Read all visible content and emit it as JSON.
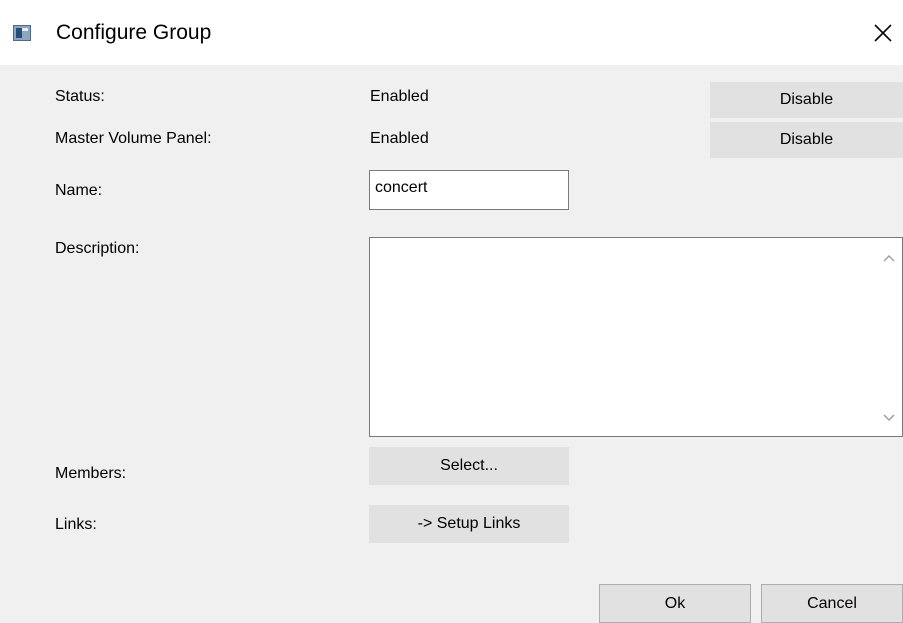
{
  "window": {
    "title": "Configure Group",
    "close_glyph": "✕",
    "icon": "app-window-icon"
  },
  "form": {
    "status": {
      "label": "Status:",
      "value": "Enabled",
      "button": "Disable"
    },
    "master_volume": {
      "label": "Master Volume Panel:",
      "value": "Enabled",
      "button": "Disable"
    },
    "name": {
      "label": "Name:",
      "value": "concert"
    },
    "description": {
      "label": "Description:",
      "value": ""
    },
    "members": {
      "label": "Members:",
      "button": "Select..."
    },
    "links": {
      "label": "Links:",
      "button": "-> Setup Links"
    }
  },
  "footer": {
    "ok_label": "Ok",
    "cancel_label": "Cancel"
  }
}
